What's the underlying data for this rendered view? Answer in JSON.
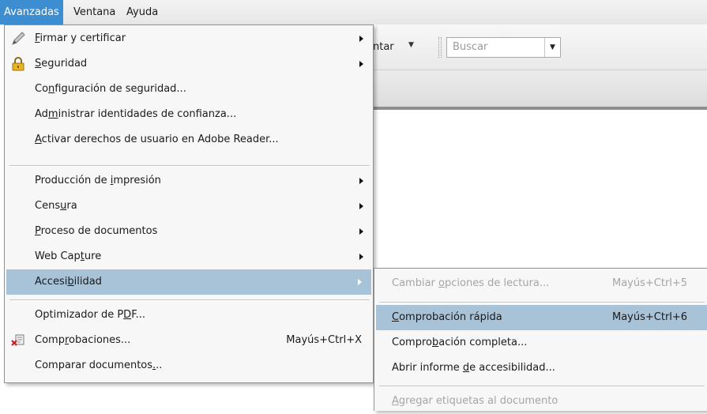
{
  "menubar": {
    "items": [
      {
        "label": "Avanzadas",
        "active": true
      },
      {
        "label": "Ventana",
        "active": false
      },
      {
        "label": "Ayuda",
        "active": false
      }
    ]
  },
  "toolbar": {
    "partial_label": "ntar",
    "search_placeholder": "Buscar"
  },
  "menu": {
    "items": [
      {
        "pre": "",
        "acc": "F",
        "post": "irmar y certificar",
        "icon": "pen-icon",
        "submenu": true
      },
      {
        "pre": "",
        "acc": "S",
        "post": "eguridad",
        "icon": "lock-icon",
        "submenu": true
      },
      {
        "pre": "Co",
        "acc": "n",
        "post": "figuración de seguridad...",
        "submenu": false
      },
      {
        "pre": "Ad",
        "acc": "m",
        "post": "inistrar identidades de confianza...",
        "submenu": false
      },
      {
        "pre": "",
        "acc": "A",
        "post": "ctivar derechos de usuario en Adobe Reader...",
        "submenu": false
      },
      {
        "pre": "Producción de ",
        "acc": "i",
        "post": "mpresión",
        "submenu": true
      },
      {
        "pre": "Cens",
        "acc": "u",
        "post": "ra",
        "submenu": true
      },
      {
        "pre": "",
        "acc": "P",
        "post": "roceso de documentos",
        "submenu": true
      },
      {
        "pre": "Web Cap",
        "acc": "t",
        "post": "ure",
        "submenu": true
      },
      {
        "pre": "Accesi",
        "acc": "b",
        "post": "ilidad",
        "submenu": true,
        "highlighted": true
      },
      {
        "pre": "Optimizador de P",
        "acc": "D",
        "post": "F...",
        "submenu": false
      },
      {
        "pre": "Comp",
        "acc": "r",
        "post": "obaciones...",
        "icon": "preflight-icon",
        "shortcut": "Mayús+Ctrl+X",
        "submenu": false
      },
      {
        "pre": "Comparar documentos",
        "acc": ".",
        "post": "..",
        "submenu": false
      }
    ]
  },
  "submenu": {
    "items": [
      {
        "pre": "Cambiar ",
        "acc": "o",
        "post": "pciones de lectura...",
        "shortcut": "Mayús+Ctrl+5",
        "disabled": true
      },
      {
        "pre": "",
        "acc": "C",
        "post": "omprobación rápida",
        "shortcut": "Mayús+Ctrl+6",
        "highlighted": true
      },
      {
        "pre": "Compro",
        "acc": "b",
        "post": "ación completa...",
        "shortcut": ""
      },
      {
        "pre": "Abrir informe ",
        "acc": "d",
        "post": "e accesibilidad...",
        "shortcut": ""
      },
      {
        "pre": "",
        "acc": "A",
        "post": "gregar etiquetas al documento",
        "shortcut": "",
        "disabled": true
      }
    ]
  },
  "colors": {
    "menubar_active": "#3d8ed1",
    "highlight": "#a8c2d8",
    "disabled_text": "#a5a5a5"
  }
}
